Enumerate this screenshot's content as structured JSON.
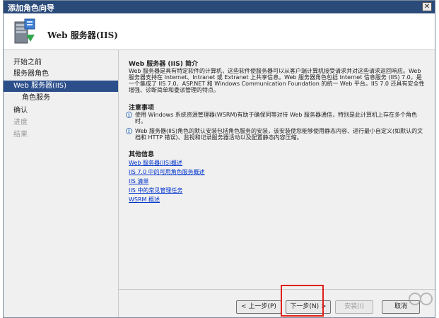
{
  "window": {
    "title": "添加角色向导",
    "close_glyph": "✕"
  },
  "header": {
    "title": "Web 服务器(IIS)",
    "icon": "server-roles-icon"
  },
  "nav": {
    "items": [
      {
        "label": "开始之前",
        "state": "normal"
      },
      {
        "label": "服务器角色",
        "state": "normal"
      },
      {
        "label": "Web 服务器(IIS)",
        "state": "active"
      },
      {
        "label": "角色服务",
        "state": "sub"
      },
      {
        "label": "确认",
        "state": "normal"
      },
      {
        "label": "进度",
        "state": "disabled"
      },
      {
        "label": "结果",
        "state": "disabled"
      }
    ]
  },
  "content": {
    "intro_title": "Web 服务器 (IIS) 简介",
    "intro_text": "Web 服务器是具有特定软件的计算机，这些软件使服务器可以从客户端计算机接受请求并对这些请求返回响应。Web 服务器支持在 Internet、Intranet 或 Extranet 上共享信息。Web 服务器角色包括 Internet 信息服务 (IIS) 7.0，是一个集成了 IIS 7.0、ASP.NET 和 Windows Communication Foundation 的统一 Web 平台。IIS 7.0 还具有安全性增强、诊断简单和委派管理的特点。",
    "notes_title": "注意事项",
    "notes": [
      "使用 Windows 系统资源管理器(WSRM)有助于确保同等对待 Web 服务器通信，特别是此计算机上存在多个角色时。",
      "Web 服务器(IIS)角色的默认安装包括角色服务的安装，该安装使您能够使用静态内容、进行最小自定义(如默认的文档和 HTTP 错误)、监视和记录服务器活动以及配置静态内容压缩。"
    ],
    "more_title": "其他信息",
    "links": [
      "Web 服务器(IIS)概述",
      "IIS 7.0 中的可用角色服务概述",
      "IIS 清单",
      "IIS 中的常见管理任务",
      "WSRM 概述"
    ]
  },
  "footer": {
    "prev_label": "< 上一步(P)",
    "next_label": "下一步(N) >",
    "install_label": "安装(I)",
    "cancel_label": "取消"
  },
  "colors": {
    "nav_active": "#2c4f8c",
    "titlebar": "#2a4a7a",
    "highlight": "#e0201a",
    "link": "#0033cc"
  }
}
